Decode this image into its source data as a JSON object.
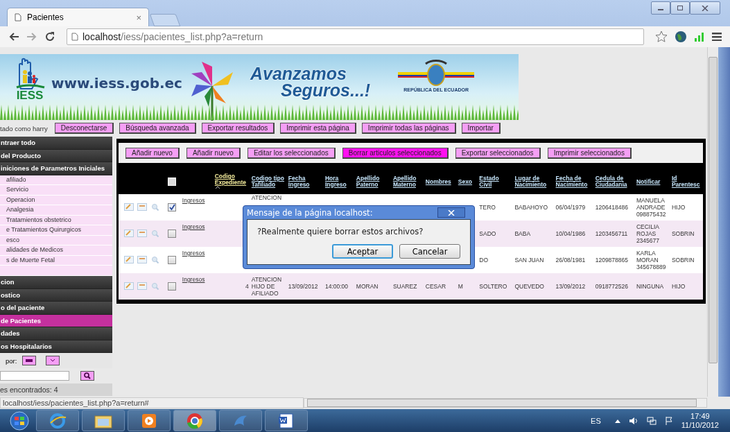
{
  "browser": {
    "tab_title": "Pacientes",
    "tab_close": "×",
    "url_host": "localhost",
    "url_path": "/iess/pacientes_list.php?a=return"
  },
  "banner": {
    "site": "www.iess.gob.ec",
    "logo_text": "IESS",
    "slogan": [
      "Avanzamos",
      "Seguros...!"
    ],
    "country": "REPÚBLICA DEL ECUADOR"
  },
  "toolbar": {
    "user_label": "tado como harry",
    "buttons": [
      "Desconectarse",
      "Búsqueda avanzada",
      "Exportar resultados",
      "Imprimir esta página",
      "Imprimir todas las páginas",
      "Importar"
    ]
  },
  "sidebar": {
    "items": [
      {
        "label": "ntraer todo",
        "kind": "header",
        "selected": false
      },
      {
        "label": "del Producto",
        "kind": "header",
        "selected": false
      },
      {
        "label": "iniciones de Parametros Iniciales",
        "kind": "header",
        "selected": false
      },
      {
        "label": "afiliado",
        "kind": "sub",
        "selected": false
      },
      {
        "label": "Servicio",
        "kind": "sub",
        "selected": false
      },
      {
        "label": "Operacion",
        "kind": "sub",
        "selected": false
      },
      {
        "label": "Analgesia",
        "kind": "sub",
        "selected": false
      },
      {
        "label": "Tratamientos obstetrico",
        "kind": "sub",
        "selected": false
      },
      {
        "label": "e Tratamientos Quirurgicos",
        "kind": "sub",
        "selected": false
      },
      {
        "label": "esco",
        "kind": "sub",
        "selected": false
      },
      {
        "label": "alidades de Medicos",
        "kind": "sub",
        "selected": false
      },
      {
        "label": "s de Muerte Fetal",
        "kind": "sub",
        "selected": false
      },
      {
        "label": "cion",
        "kind": "header",
        "selected": false
      },
      {
        "label": "ostico",
        "kind": "header",
        "selected": false
      },
      {
        "label": "o del paciente",
        "kind": "header",
        "selected": false
      },
      {
        "label": "de Pacientes",
        "kind": "header",
        "selected": true
      },
      {
        "label": "dades",
        "kind": "header",
        "selected": false
      },
      {
        "label": "os Hospitalarios",
        "kind": "header",
        "selected": false
      }
    ],
    "sort_label": "por:",
    "results": "es encontrados: 4"
  },
  "actions": [
    {
      "label": "Añadir nuevo",
      "highlighted": false
    },
    {
      "label": "Añadir nuevo",
      "highlighted": false
    },
    {
      "label": "Editar los seleccionados",
      "highlighted": false
    },
    {
      "label": "Borrar articulos seleccionados",
      "highlighted": true
    },
    {
      "label": "Exportar seleccionados",
      "highlighted": false
    },
    {
      "label": "Imprimir seleccionados",
      "highlighted": false
    }
  ],
  "table": {
    "select_all": false,
    "columns": [
      {
        "label": "Codigo Expediente",
        "sorted": true
      },
      {
        "label": "Codigo tipo Tafiliado",
        "sorted": false
      },
      {
        "label": "Fecha Ingreso",
        "sorted": false
      },
      {
        "label": "Hora Ingreso",
        "sorted": false
      },
      {
        "label": "Apellido Paterno",
        "sorted": false
      },
      {
        "label": "Apellido Materno",
        "sorted": false
      },
      {
        "label": "Nombres",
        "sorted": false
      },
      {
        "label": "Sexo",
        "sorted": false
      },
      {
        "label": "Estado Civil",
        "sorted": false
      },
      {
        "label": "Lugar de Nacimiento",
        "sorted": false
      },
      {
        "label": "Fecha de Nacimiento",
        "sorted": false
      },
      {
        "label": "Cedula de Ciudadania",
        "sorted": false
      },
      {
        "label": "Notificar",
        "sorted": false
      },
      {
        "label": "Id Parentesc",
        "sorted": false
      }
    ],
    "rows": [
      {
        "selected": true,
        "link": "Ingresos",
        "peek": "ATENCION",
        "cells": [
          "TERO",
          "BABAHOYO",
          "06/04/1979",
          "1206418486",
          "MANUELA ANDRADE 098875432",
          "HIJO"
        ]
      },
      {
        "selected": false,
        "link": "Ingresos",
        "cells": [
          "SADO",
          "BABA",
          "10/04/1986",
          "1203456711",
          "CECILIA ROJAS 2345677",
          "SOBRIN"
        ]
      },
      {
        "selected": false,
        "link": "Ingresos",
        "cells": [
          "DO",
          "SAN JUAN",
          "26/08/1981",
          "1209878865",
          "KARLA MORAN 345678889",
          "SOBRIN"
        ]
      },
      {
        "selected": false,
        "link": "Ingresos",
        "cells": [
          "4",
          "ATENCION HIJO DE AFILIADO",
          "13/09/2012",
          "14:00:00",
          "MORAN",
          "SUAREZ",
          "CESAR",
          "M",
          "SOLTERO",
          "QUEVEDO",
          "13/09/2012",
          "0918772526",
          "NINGUNA",
          "HIJO"
        ]
      }
    ]
  },
  "dialog": {
    "title": "Mensaje de la página localhost:",
    "message": "?Realmente quiere borrar estos archivos?",
    "buttons": [
      {
        "label": "Aceptar",
        "focused": true
      },
      {
        "label": "Cancelar",
        "focused": false
      }
    ]
  },
  "status_url": "localhost/iess/pacientes_list.php?a=return#",
  "taskbar": {
    "language": "ES",
    "time": "17:49",
    "date": "11/10/2012"
  }
}
